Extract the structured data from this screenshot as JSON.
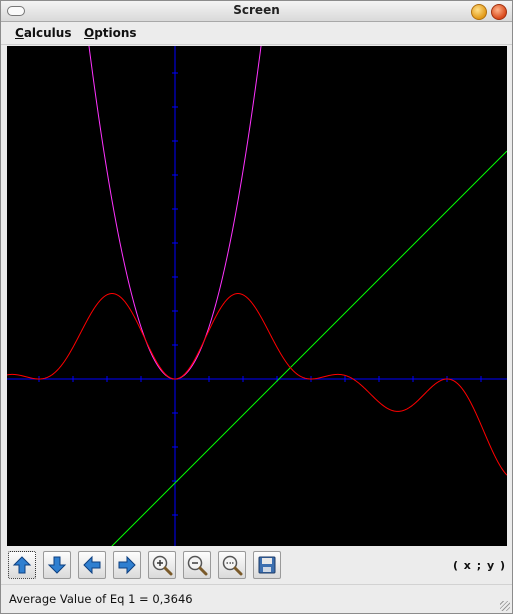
{
  "window": {
    "title": "Screen"
  },
  "menu": [
    {
      "id": "calculus",
      "mnemonic": "C",
      "rest": "alculus"
    },
    {
      "id": "options",
      "mnemonic": "O",
      "rest": "ptions"
    }
  ],
  "toolbar": {
    "buttons": [
      {
        "name": "move-up-button",
        "icon": "arrow-up-icon"
      },
      {
        "name": "move-down-button",
        "icon": "arrow-down-icon"
      },
      {
        "name": "move-left-button",
        "icon": "arrow-left-icon"
      },
      {
        "name": "move-right-button",
        "icon": "arrow-right-icon"
      },
      {
        "name": "zoom-in-button",
        "icon": "zoom-in-icon"
      },
      {
        "name": "zoom-out-button",
        "icon": "zoom-out-icon"
      },
      {
        "name": "zoom-reset-button",
        "icon": "zoom-reset-icon"
      },
      {
        "name": "save-button",
        "icon": "floppy-disk-icon"
      }
    ],
    "coordinate_readout": "( x ; y )"
  },
  "status": {
    "text": "Average Value of Eq 1 = 0,3646"
  },
  "colors": {
    "background": "#000000",
    "axes": "#0000ff",
    "eq_red": "#ff0000",
    "eq_magenta": "#ff33ff",
    "eq_green": "#00ff00"
  }
}
